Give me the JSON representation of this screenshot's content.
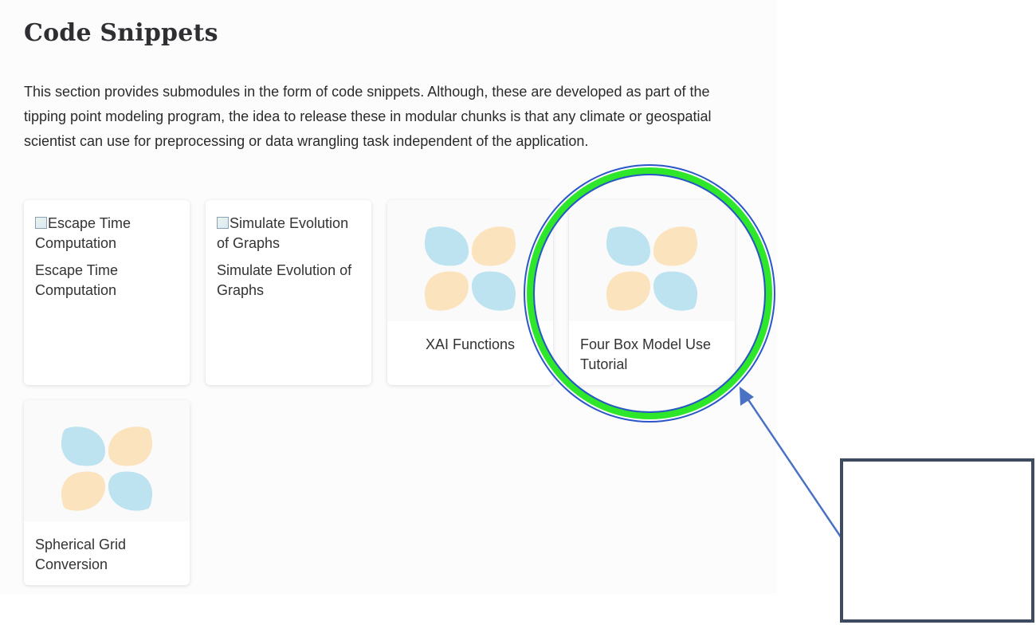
{
  "page": {
    "title": "Code Snippets",
    "intro": "This section provides submodules in the form of code snippets. Although, these are developed as part of the tipping point modeling program, the idea to release these in modular chunks is that any climate or geospatial scientist can use for preprocessing or data wrangling task independent of the application."
  },
  "cards": [
    {
      "image_alt": "Escape Time Computation",
      "image_state": "broken",
      "label": "Escape Time Computation"
    },
    {
      "image_alt": "Simulate Evolution of Graphs",
      "image_state": "broken",
      "label": "Simulate Evolution of Graphs"
    },
    {
      "image_icon": "four-petal-logo-icon",
      "label": "XAI Functions"
    },
    {
      "image_icon": "four-petal-logo-icon",
      "label": "Four Box Model Use Tutorial"
    },
    {
      "image_icon": "four-petal-logo-icon",
      "label": "Spherical Grid Conversion"
    }
  ],
  "logo_colors": {
    "blue": "#bde3f0",
    "peach": "#fbe3be"
  },
  "annotation": {
    "ring_color": "#2ee62a",
    "ring_outline_color": "#2b55c8",
    "arrow_color": "#4a72c4",
    "box_border_color": "#3e4a60"
  }
}
